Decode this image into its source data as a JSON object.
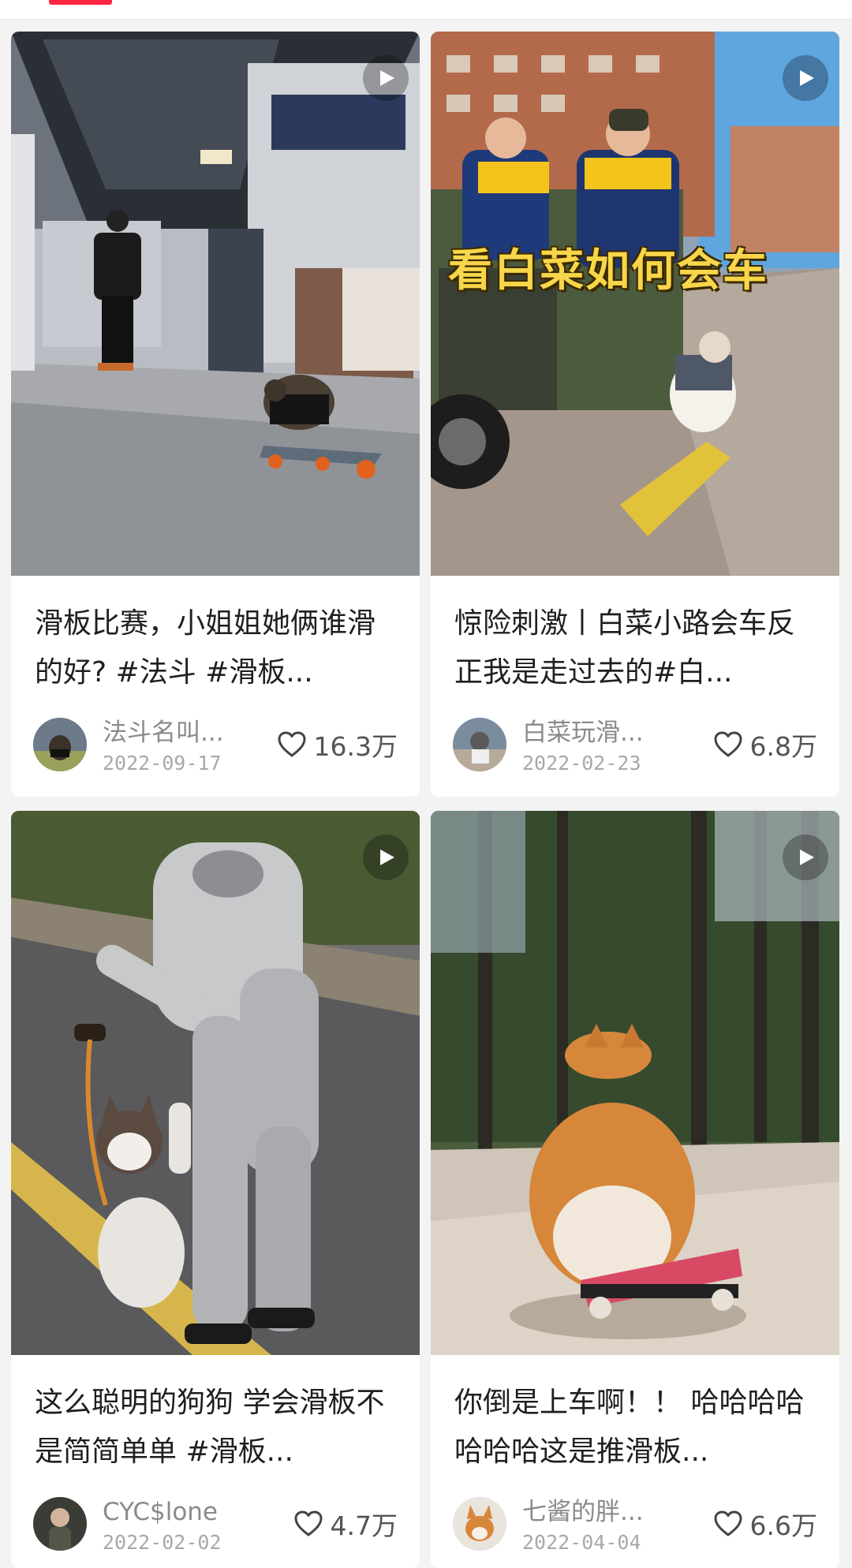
{
  "cards": [
    {
      "title": "滑板比赛，小姐姐她俩谁滑的好? #法斗 #滑板...",
      "author": "法斗名叫...",
      "date": "2022-09-17",
      "likes": "16.3万",
      "thumbnail_icon": "skateboarding-dog-mall-image",
      "avatar_icon": "dog-avatar"
    },
    {
      "title": "惊险刺激丨白菜小路会车反正我是走过去的#白...",
      "author": "白菜玩滑...",
      "date": "2022-02-23",
      "likes": "6.8万",
      "overlay": "看白菜如何会车",
      "thumbnail_icon": "dog-skateboard-tricycle-image",
      "avatar_icon": "dog-avatar"
    },
    {
      "title": "这么聪明的狗狗 学会滑板不是简简单单 #滑板...",
      "author": "CYC$lone",
      "date": "2022-02-02",
      "likes": "4.7万",
      "thumbnail_icon": "husky-pup-high-five-image",
      "avatar_icon": "person-avatar"
    },
    {
      "title": "你倒是上车啊！！ 哈哈哈哈哈哈哈这是推滑板...",
      "author": "七酱的胖...",
      "date": "2022-04-04",
      "likes": "6.6万",
      "thumbnail_icon": "corgi-on-skateboard-image",
      "avatar_icon": "corgi-avatar"
    }
  ],
  "ui": {
    "play_icon": "play-icon",
    "like_icon": "heart-outline-icon",
    "accent_color": "#ff2442"
  }
}
